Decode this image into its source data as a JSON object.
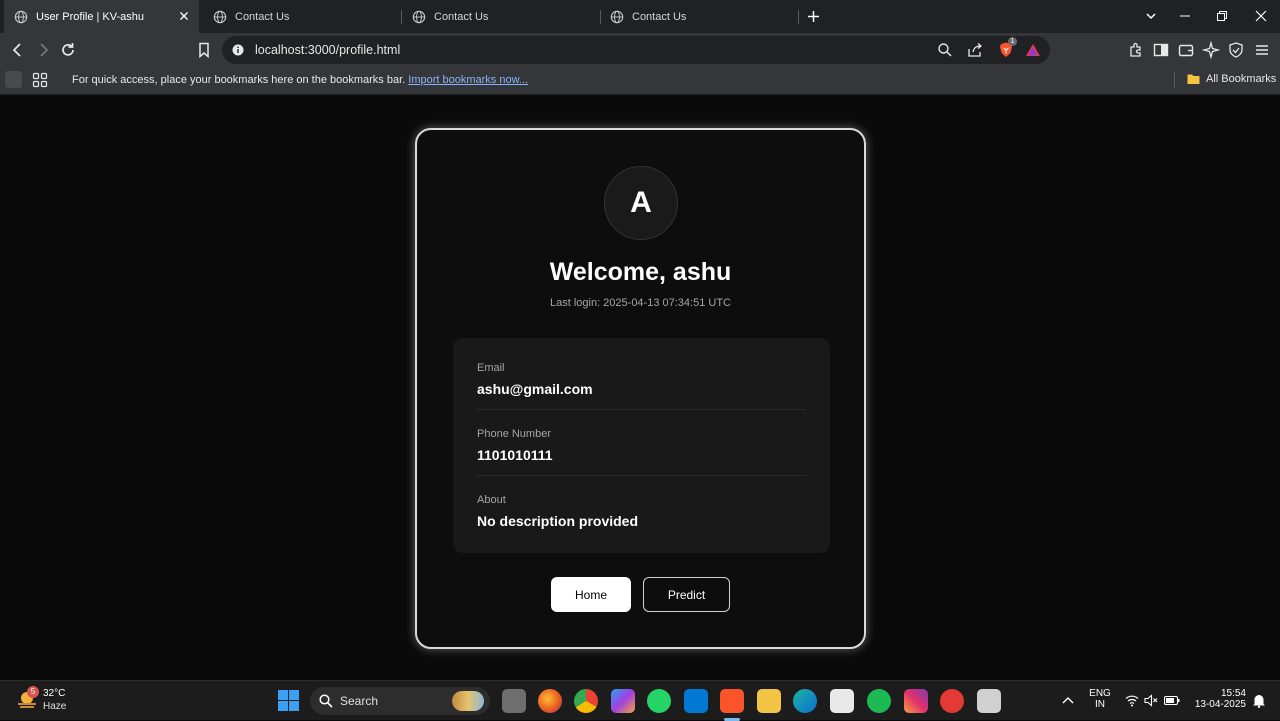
{
  "browser": {
    "tabs": [
      {
        "label": "User Profile | KV-ashu",
        "active": true
      },
      {
        "label": "Contact Us",
        "active": false
      },
      {
        "label": "Contact Us",
        "active": false
      },
      {
        "label": "Contact Us",
        "active": false
      }
    ],
    "address": "localhost:3000/profile.html",
    "shield_badge": "1",
    "bookmarks_bar": {
      "text": "For quick access, place your bookmarks here on the bookmarks bar.",
      "link": "Import bookmarks now...",
      "all_bookmarks": "All Bookmarks"
    }
  },
  "profile": {
    "avatar_initial": "A",
    "welcome": "Welcome, ashu",
    "last_login": "Last login: 2025-04-13 07:34:51 UTC",
    "fields": [
      {
        "label": "Email",
        "value": "ashu@gmail.com"
      },
      {
        "label": "Phone Number",
        "value": "1101010111"
      },
      {
        "label": "About",
        "value": "No description provided"
      }
    ],
    "buttons": {
      "home": "Home",
      "predict": "Predict"
    }
  },
  "taskbar": {
    "weather_temp": "32°C",
    "weather_desc": "Haze",
    "weather_badge": "5",
    "search": "Search",
    "lang_top": "ENG",
    "lang_bottom": "IN",
    "time": "15:54",
    "date": "13-04-2025"
  },
  "colors": {
    "page_bg": "#0a0a0a",
    "card_border": "#d9d9d9",
    "info_bg": "#191919",
    "brave_orange": "#fb542b"
  }
}
